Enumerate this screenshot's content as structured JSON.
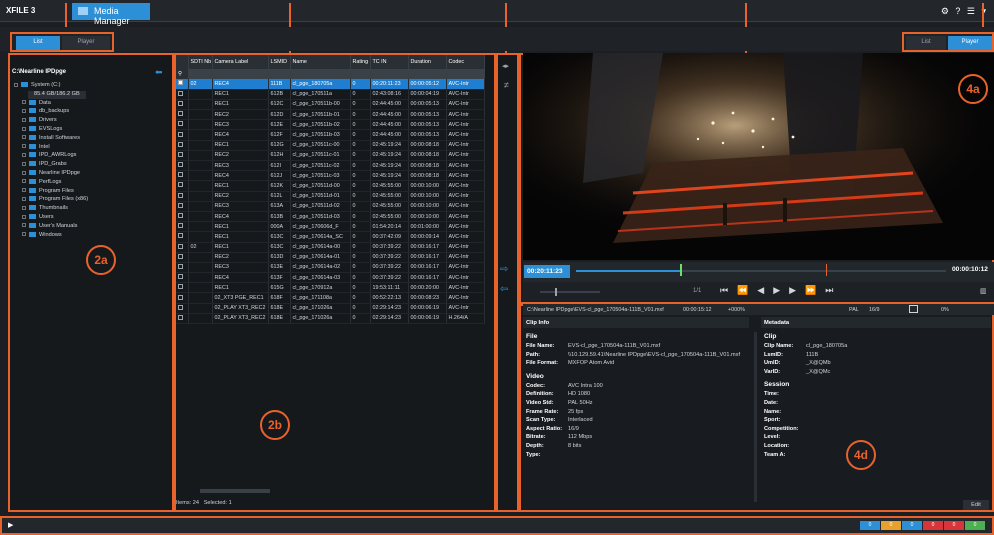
{
  "app": {
    "brand": "XFILE 3",
    "tab": "Media Manager",
    "top_icons": "⚙ ? ☰ ▾"
  },
  "view_left": {
    "list": "List",
    "player": "Player"
  },
  "view_right": {
    "list": "List",
    "player": "Player"
  },
  "tree": {
    "root": "C:\\Nearline IPDpge",
    "items": [
      "System (C:)",
      "85.4 GB/186.2 GB",
      "Data",
      "db_backups",
      "Drivers",
      "EVSLogs",
      "Install Softwares",
      "Intel",
      "IPD_AWRLogs",
      "IPD_Grabs",
      "Nearline IPDpge",
      "PerfLogs",
      "Program Files",
      "Program Files (x86)",
      "Thumbnails",
      "Users",
      "User's Manuals",
      "Windows"
    ]
  },
  "grid": {
    "headers": [
      "",
      "SDTI Nb",
      "Camera Label",
      "LSMID",
      "Name",
      "Rating",
      "TC IN",
      "Duration",
      "Codec"
    ],
    "rows": [
      [
        "",
        "02",
        "REC4",
        "111B",
        "cl_pge_180705a",
        "0",
        "00:20:11:23",
        "00:00:05:12",
        "AVC-Intr"
      ],
      [
        "",
        "",
        "REC1",
        "612B",
        "cl_pge_170511a",
        "0",
        "02:43:08:16",
        "00:00:04:19",
        "AVC-Intr"
      ],
      [
        "",
        "",
        "REC1",
        "612C",
        "cl_pge_170511b-00",
        "0",
        "02:44:45:00",
        "00:00:05:13",
        "AVC-Intr"
      ],
      [
        "",
        "",
        "REC2",
        "612D",
        "cl_pge_170511b-01",
        "0",
        "02:44:45:00",
        "00:00:05:13",
        "AVC-Intr"
      ],
      [
        "",
        "",
        "REC3",
        "612E",
        "cl_pge_170511b-02",
        "0",
        "02:44:45:00",
        "00:00:05:13",
        "AVC-Intr"
      ],
      [
        "",
        "",
        "REC4",
        "612F",
        "cl_pge_170511b-03",
        "0",
        "02:44:45:00",
        "00:00:05:13",
        "AVC-Intr"
      ],
      [
        "",
        "",
        "REC1",
        "612G",
        "cl_pge_170511c-00",
        "0",
        "02:45:19:24",
        "00:00:08:18",
        "AVC-Intr"
      ],
      [
        "",
        "",
        "REC2",
        "612H",
        "cl_pge_170511c-01",
        "0",
        "02:45:19:24",
        "00:00:08:18",
        "AVC-Intr"
      ],
      [
        "",
        "",
        "REC3",
        "612I",
        "cl_pge_170511c-02",
        "0",
        "02:45:19:24",
        "00:00:08:18",
        "AVC-Intr"
      ],
      [
        "",
        "",
        "REC4",
        "612J",
        "cl_pge_170511c-03",
        "0",
        "02:45:19:24",
        "00:00:08:18",
        "AVC-Intr"
      ],
      [
        "",
        "",
        "REC1",
        "612K",
        "cl_pge_170511d-00",
        "0",
        "02:45:55:00",
        "00:00:10:00",
        "AVC-Intr"
      ],
      [
        "",
        "",
        "REC2",
        "612L",
        "cl_pge_170511d-01",
        "0",
        "02:45:55:00",
        "00:00:10:00",
        "AVC-Intr"
      ],
      [
        "",
        "",
        "REC3",
        "613A",
        "cl_pge_170511d-02",
        "0",
        "02:45:55:00",
        "00:00:10:00",
        "AVC-Intr"
      ],
      [
        "",
        "",
        "REC4",
        "613B",
        "cl_pge_170511d-03",
        "0",
        "02:45:55:00",
        "00:00:10:00",
        "AVC-Intr"
      ],
      [
        "",
        "",
        "REC1",
        "000A",
        "cl_pge_170606d_F",
        "0",
        "01:54:20:14",
        "00:01:00:00",
        "AVC-Intr"
      ],
      [
        "",
        "",
        "REC1",
        "613C",
        "cl_pge_170614a_SC",
        "0",
        "00:37:42:09",
        "00:00:09:14",
        "AVC-Intr"
      ],
      [
        "",
        "02",
        "REC1",
        "613C",
        "cl_pge_170614a-00",
        "0",
        "00:37:39:22",
        "00:00:16:17",
        "AVC-Intr"
      ],
      [
        "",
        "",
        "REC2",
        "613D",
        "cl_pge_170614a-01",
        "0",
        "00:37:39:22",
        "00:00:16:17",
        "AVC-Intr"
      ],
      [
        "",
        "",
        "REC3",
        "613E",
        "cl_pge_170614a-02",
        "0",
        "00:37:39:22",
        "00:00:16:17",
        "AVC-Intr"
      ],
      [
        "",
        "",
        "REC4",
        "613F",
        "cl_pge_170614a-03",
        "0",
        "00:37:39:22",
        "00:00:16:17",
        "AVC-Intr"
      ],
      [
        "",
        "",
        "REC1",
        "615G",
        "cl_pge_170912a",
        "0",
        "19:53:11:11",
        "00:00:20:00",
        "AVC-Intr"
      ],
      [
        "",
        "",
        "02_XT3 PGE_REC1",
        "618F",
        "cl_pge_171108a",
        "0",
        "00:52:22:13",
        "00:00:08:23",
        "AVC-Intr"
      ],
      [
        "",
        "",
        "02_PLAY XT3_REC2",
        "618E",
        "cl_pge_171026a",
        "0",
        "02:29:14:23",
        "00:00:06:19",
        "AVC-Intr"
      ],
      [
        "",
        "",
        "02_PLAY XT3_REC2",
        "618E",
        "cl_pge_171026a",
        "0",
        "02:29:14:23",
        "00:00:06:19",
        "H.264/A"
      ]
    ],
    "footer_items": "Items: 24",
    "footer_selected": "Selected: 1"
  },
  "player": {
    "tc_current": "00:20:11:23",
    "tc_end": "00:00:10:12",
    "speed": "1/1",
    "progress": 0.28
  },
  "info": {
    "path": "C:\\Nearline IPDpge\\EVS-cl_pge_170504a-111B_V01.mxf",
    "duration": "00:00:15:12",
    "speed": "+000%",
    "format": "PAL",
    "aspect": "16/9",
    "vol": "0%",
    "clip_info_title": "Clip Info",
    "metadata_title": "Metadata",
    "file_section": "File",
    "file": [
      {
        "k": "File Name:",
        "v": "EVS-cl_pge_170504a-111B_V01.mxf"
      },
      {
        "k": "Path:",
        "v": "\\\\10.129.59.41\\Nearline IPDpge\\EVS-cl_pge_170504a-111B_V01.mxf"
      },
      {
        "k": "File Format:",
        "v": "MXFOP Atom Avid"
      }
    ],
    "video_section": "Video",
    "video": [
      {
        "k": "Codec:",
        "v": "AVC Intra 100"
      },
      {
        "k": "Definition:",
        "v": "HD 1080"
      },
      {
        "k": "Video Std:",
        "v": "PAL 50Hz"
      },
      {
        "k": "Frame Rate:",
        "v": "25 fps"
      },
      {
        "k": "Scan Type:",
        "v": "Interlaced"
      },
      {
        "k": "Aspect Ratio:",
        "v": "16/9"
      },
      {
        "k": "Bitrate:",
        "v": "112 Mbps"
      },
      {
        "k": "Depth:",
        "v": "8 bits"
      },
      {
        "k": "Type:",
        "v": ""
      }
    ],
    "clip_section": "Clip",
    "clip": [
      {
        "k": "Clip Name:",
        "v": "cl_pge_180705a"
      },
      {
        "k": "LsmID:",
        "v": "111B"
      },
      {
        "k": "UmID:",
        "v": "_X@QMb"
      },
      {
        "k": "VarID:",
        "v": "_X@QMc"
      }
    ],
    "session_section": "Session",
    "session": [
      {
        "k": "Time:",
        "v": ""
      },
      {
        "k": "Date:",
        "v": ""
      },
      {
        "k": "Name:",
        "v": ""
      },
      {
        "k": "Sport:",
        "v": ""
      },
      {
        "k": "Competition:",
        "v": ""
      },
      {
        "k": "Level:",
        "v": ""
      },
      {
        "k": "Location:",
        "v": ""
      },
      {
        "k": "Team A:",
        "v": ""
      }
    ],
    "edit": "Edit"
  },
  "callouts": {
    "a2": "2a",
    "b2": "2b",
    "a4": "4a",
    "d4": "4d"
  },
  "status_chips": [
    "0",
    "0",
    "0",
    "0",
    "0",
    "0"
  ],
  "colors": {
    "accent": "#2d8fd6",
    "callout": "#e8622c",
    "selected_row": "#1f7ed0"
  }
}
